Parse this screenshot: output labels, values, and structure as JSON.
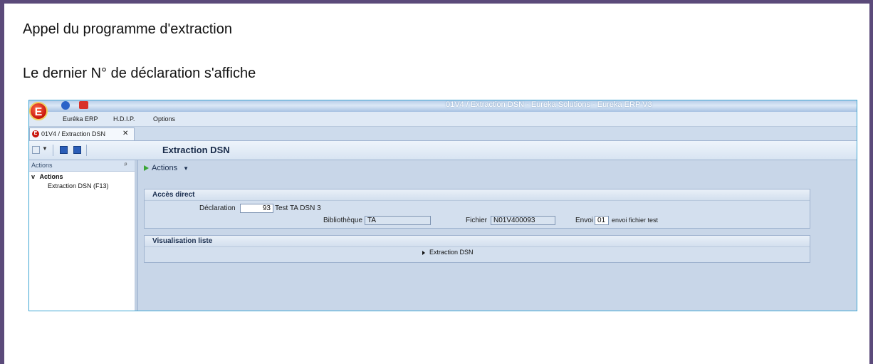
{
  "captions": {
    "line1": "Appel du programme d'extraction",
    "line2": "Le dernier N° de déclaration s'affiche"
  },
  "app": {
    "window_title": "01V4 / Extraction DSN - Eureka Solutions - Eureka ERP V3",
    "logo_letter": "E",
    "menu": [
      "Eurêka ERP",
      "H.D.I.P.",
      "Options"
    ],
    "tab": {
      "label": "01V4 / Extraction DSN",
      "close": "✕"
    },
    "toolbar": {
      "title": "Extraction DSN"
    },
    "left_panel": {
      "header": "Actions",
      "pin": "ᵖ",
      "group": "Actions",
      "group_chevron": "v",
      "items": [
        "Extraction DSN (F13)"
      ]
    },
    "main": {
      "actions_label": "Actions",
      "acces_direct": {
        "title": "Accès direct",
        "declaration_label": "Déclaration",
        "declaration_value": "93",
        "declaration_desc": "Test TA DSN 3",
        "bibliotheque_label": "Bibliothèque",
        "bibliotheque_value": "TA",
        "fichier_label": "Fichier",
        "fichier_value": "N01V400093",
        "envoi_label": "Envoi",
        "envoi_value": "01",
        "envoi_desc": "envoi fichier test"
      },
      "visualisation": {
        "title": "Visualisation liste",
        "item": "Extraction DSN"
      }
    }
  }
}
